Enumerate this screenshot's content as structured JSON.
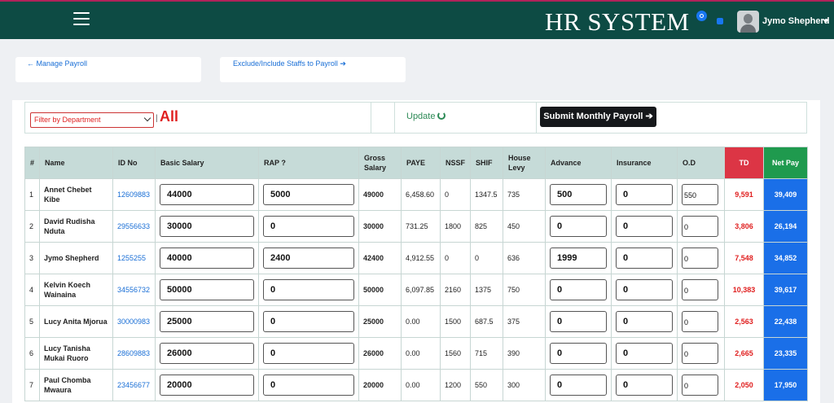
{
  "header": {
    "brand": "HR SYSTEM",
    "user_name": "Jymo Shepherd"
  },
  "links": {
    "manage_payroll": "← Manage Payroll",
    "exclude_include": "Exclude/Include Staffs to Payroll ➔"
  },
  "toolbar": {
    "filter_placeholder": "Filter by Department",
    "separator": "|",
    "filter_value": "All",
    "update_label": "Update",
    "submit_label": "Submit Monthly Payroll ➔"
  },
  "table": {
    "columns": [
      "#",
      "Name",
      "ID No",
      "Basic Salary",
      "RAP ?",
      "Gross Salary",
      "PAYE",
      "NSSF",
      "SHIF",
      "House Levy",
      "Advance",
      "Insurance",
      "O.D",
      "TD",
      "Net Pay"
    ],
    "rows": [
      {
        "idx": "1",
        "name": "Annet Chebet Kibe",
        "id_no": "12609883",
        "basic": "44000",
        "rap": "5000",
        "gross": "49000",
        "paye": "6,458.60",
        "nssf": "0",
        "shif": "1347.5",
        "house_levy": "735",
        "advance": "500",
        "insurance": "0",
        "od": "550",
        "td": "9,591",
        "net": "39,409"
      },
      {
        "idx": "2",
        "name": "David Rudisha Nduta",
        "id_no": "29556633",
        "basic": "30000",
        "rap": "0",
        "gross": "30000",
        "paye": "731.25",
        "nssf": "1800",
        "shif": "825",
        "house_levy": "450",
        "advance": "0",
        "insurance": "0",
        "od": "0",
        "td": "3,806",
        "net": "26,194"
      },
      {
        "idx": "3",
        "name": "Jymo Shepherd",
        "id_no": "1255255",
        "basic": "40000",
        "rap": "2400",
        "gross": "42400",
        "paye": "4,912.55",
        "nssf": "0",
        "shif": "0",
        "house_levy": "636",
        "advance": "1999",
        "insurance": "0",
        "od": "0",
        "td": "7,548",
        "net": "34,852"
      },
      {
        "idx": "4",
        "name": "Kelvin Koech Wainaina",
        "id_no": "34556732",
        "basic": "50000",
        "rap": "0",
        "gross": "50000",
        "paye": "6,097.85",
        "nssf": "2160",
        "shif": "1375",
        "house_levy": "750",
        "advance": "0",
        "insurance": "0",
        "od": "0",
        "td": "10,383",
        "net": "39,617"
      },
      {
        "idx": "5",
        "name": "Lucy Anita Mjorua",
        "id_no": "30000983",
        "basic": "25000",
        "rap": "0",
        "gross": "25000",
        "paye": "0.00",
        "nssf": "1500",
        "shif": "687.5",
        "house_levy": "375",
        "advance": "0",
        "insurance": "0",
        "od": "0",
        "td": "2,563",
        "net": "22,438"
      },
      {
        "idx": "6",
        "name": "Lucy Tanisha Mukai Ruoro",
        "id_no": "28609883",
        "basic": "26000",
        "rap": "0",
        "gross": "26000",
        "paye": "0.00",
        "nssf": "1560",
        "shif": "715",
        "house_levy": "390",
        "advance": "0",
        "insurance": "0",
        "od": "0",
        "td": "2,665",
        "net": "23,335"
      },
      {
        "idx": "7",
        "name": "Paul Chomba Mwaura",
        "id_no": "23456677",
        "basic": "20000",
        "rap": "0",
        "gross": "20000",
        "paye": "0.00",
        "nssf": "1200",
        "shif": "550",
        "house_levy": "300",
        "advance": "0",
        "insurance": "0",
        "od": "0",
        "td": "2,050",
        "net": "17,950"
      }
    ]
  },
  "icons": [
    "menu-icon",
    "notification-icon",
    "message-icon",
    "avatar",
    "refresh-icon",
    "caret-down-icon"
  ],
  "colors": {
    "header_bg": "#0d4b44",
    "td_header": "#dc3545",
    "net_header": "#1f9a4e",
    "net_cell": "#1a6fe8",
    "link": "#1a6fd6",
    "danger": "#e02020"
  }
}
